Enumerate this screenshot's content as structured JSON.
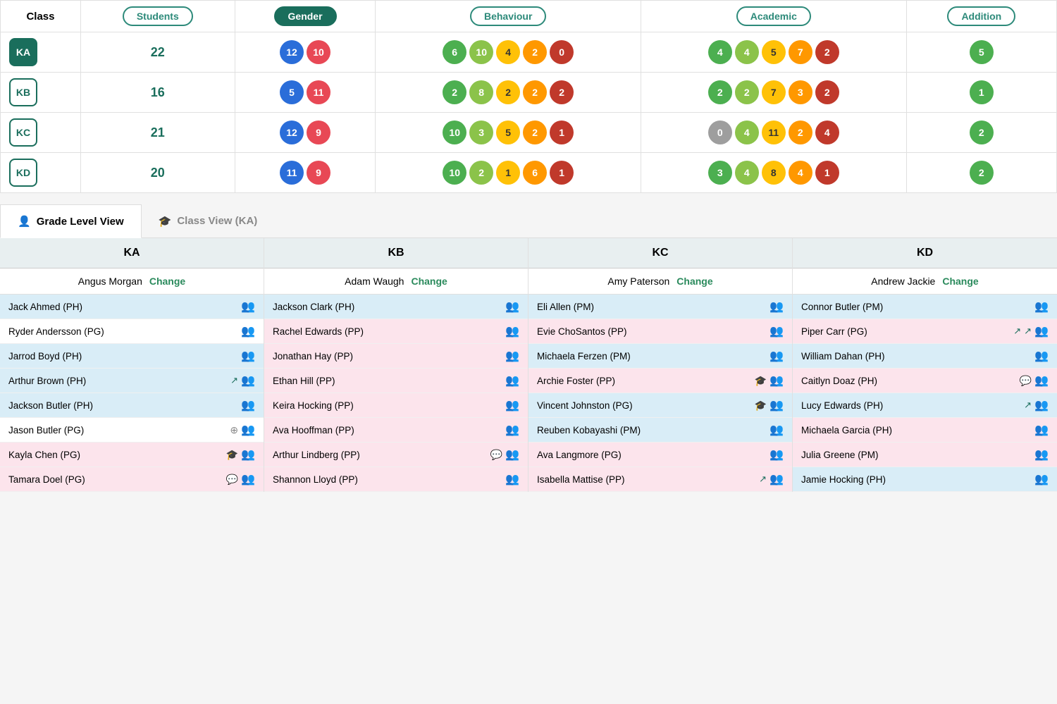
{
  "header": {
    "class_label": "Class",
    "students_label": "Students",
    "gender_label": "Gender",
    "behaviour_label": "Behaviour",
    "academic_label": "Academic",
    "additional_label": "Addition"
  },
  "rows": [
    {
      "class": "KA",
      "class_style": "filled",
      "students": "22",
      "gender": [
        {
          "val": "12",
          "color": "c-blue"
        },
        {
          "val": "10",
          "color": "c-red"
        }
      ],
      "behaviour": [
        {
          "val": "6",
          "color": "c-green"
        },
        {
          "val": "10",
          "color": "c-lightgreen"
        },
        {
          "val": "4",
          "color": "c-yellow"
        },
        {
          "val": "2",
          "color": "c-orange"
        },
        {
          "val": "0",
          "color": "c-darkred"
        }
      ],
      "academic": [
        {
          "val": "4",
          "color": "c-green"
        },
        {
          "val": "4",
          "color": "c-lightgreen"
        },
        {
          "val": "5",
          "color": "c-yellow"
        },
        {
          "val": "7",
          "color": "c-orange"
        },
        {
          "val": "2",
          "color": "c-darkred"
        }
      ],
      "additional": [
        {
          "val": "5",
          "color": "c-green"
        }
      ]
    },
    {
      "class": "KB",
      "class_style": "outline",
      "students": "16",
      "gender": [
        {
          "val": "5",
          "color": "c-blue"
        },
        {
          "val": "11",
          "color": "c-red"
        }
      ],
      "behaviour": [
        {
          "val": "2",
          "color": "c-green"
        },
        {
          "val": "8",
          "color": "c-lightgreen"
        },
        {
          "val": "2",
          "color": "c-yellow"
        },
        {
          "val": "2",
          "color": "c-orange"
        },
        {
          "val": "2",
          "color": "c-darkred"
        }
      ],
      "academic": [
        {
          "val": "2",
          "color": "c-green"
        },
        {
          "val": "2",
          "color": "c-lightgreen"
        },
        {
          "val": "7",
          "color": "c-yellow"
        },
        {
          "val": "3",
          "color": "c-orange"
        },
        {
          "val": "2",
          "color": "c-darkred"
        }
      ],
      "additional": [
        {
          "val": "1",
          "color": "c-green"
        }
      ]
    },
    {
      "class": "KC",
      "class_style": "outline",
      "students": "21",
      "gender": [
        {
          "val": "12",
          "color": "c-blue"
        },
        {
          "val": "9",
          "color": "c-red"
        }
      ],
      "behaviour": [
        {
          "val": "10",
          "color": "c-green"
        },
        {
          "val": "3",
          "color": "c-lightgreen"
        },
        {
          "val": "5",
          "color": "c-yellow"
        },
        {
          "val": "2",
          "color": "c-orange"
        },
        {
          "val": "1",
          "color": "c-darkred"
        }
      ],
      "academic": [
        {
          "val": "0",
          "color": "c-gray"
        },
        {
          "val": "4",
          "color": "c-lightgreen"
        },
        {
          "val": "11",
          "color": "c-yellow"
        },
        {
          "val": "2",
          "color": "c-orange"
        },
        {
          "val": "4",
          "color": "c-darkred"
        }
      ],
      "additional": [
        {
          "val": "2",
          "color": "c-green"
        }
      ]
    },
    {
      "class": "KD",
      "class_style": "outline",
      "students": "20",
      "gender": [
        {
          "val": "11",
          "color": "c-blue"
        },
        {
          "val": "9",
          "color": "c-red"
        }
      ],
      "behaviour": [
        {
          "val": "10",
          "color": "c-green"
        },
        {
          "val": "2",
          "color": "c-lightgreen"
        },
        {
          "val": "1",
          "color": "c-yellow"
        },
        {
          "val": "6",
          "color": "c-orange"
        },
        {
          "val": "1",
          "color": "c-darkred"
        }
      ],
      "academic": [
        {
          "val": "3",
          "color": "c-green"
        },
        {
          "val": "4",
          "color": "c-lightgreen"
        },
        {
          "val": "8",
          "color": "c-yellow"
        },
        {
          "val": "4",
          "color": "c-orange"
        },
        {
          "val": "1",
          "color": "c-darkred"
        }
      ],
      "additional": [
        {
          "val": "2",
          "color": "c-green"
        }
      ]
    }
  ],
  "tabs": [
    {
      "label": "Grade Level View",
      "icon": "👤",
      "active": true
    },
    {
      "label": "Class View (KA)",
      "icon": "🎓",
      "active": false
    }
  ],
  "columns": [
    {
      "header": "KA",
      "teacher": "Angus Morgan",
      "students": [
        {
          "name": "Jack Ahmed (PH)",
          "bg": "bg-blue",
          "icons": [
            "group"
          ]
        },
        {
          "name": "Ryder Andersson (PG)",
          "bg": "bg-white",
          "icons": [
            "group"
          ]
        },
        {
          "name": "Jarrod Boyd (PH)",
          "bg": "bg-blue",
          "icons": [
            "group"
          ]
        },
        {
          "name": "Arthur Brown (PH)",
          "bg": "bg-blue",
          "icons": [
            "arrow-up",
            "group"
          ]
        },
        {
          "name": "Jackson Butler (PH)",
          "bg": "bg-blue",
          "icons": [
            "group"
          ]
        },
        {
          "name": "Jason Butler (PG)",
          "bg": "bg-white",
          "icons": [
            "plus",
            "group"
          ]
        },
        {
          "name": "Kayla Chen (PG)",
          "bg": "bg-pink",
          "icons": [
            "hat",
            "group"
          ]
        },
        {
          "name": "Tamara Doel (PG)",
          "bg": "bg-pink",
          "icons": [
            "chat",
            "group"
          ]
        }
      ]
    },
    {
      "header": "KB",
      "teacher": "Adam Waugh",
      "students": [
        {
          "name": "Jackson Clark (PH)",
          "bg": "bg-blue",
          "icons": [
            "group"
          ]
        },
        {
          "name": "Rachel Edwards (PP)",
          "bg": "bg-pink",
          "icons": [
            "group"
          ]
        },
        {
          "name": "Jonathan Hay (PP)",
          "bg": "bg-pink",
          "icons": [
            "group"
          ]
        },
        {
          "name": "Ethan Hill (PP)",
          "bg": "bg-pink",
          "icons": [
            "group"
          ]
        },
        {
          "name": "Keira Hocking (PP)",
          "bg": "bg-pink",
          "icons": [
            "group"
          ]
        },
        {
          "name": "Ava Hooffman (PP)",
          "bg": "bg-pink",
          "icons": [
            "group"
          ]
        },
        {
          "name": "Arthur Lindberg (PP)",
          "bg": "bg-pink",
          "icons": [
            "chat",
            "group"
          ]
        },
        {
          "name": "Shannon Lloyd (PP)",
          "bg": "bg-pink",
          "icons": [
            "group"
          ]
        }
      ]
    },
    {
      "header": "KC",
      "teacher": "Amy Paterson",
      "students": [
        {
          "name": "Eli Allen (PM)",
          "bg": "bg-blue",
          "icons": [
            "group"
          ]
        },
        {
          "name": "Evie ChoSantos (PP)",
          "bg": "bg-pink",
          "icons": [
            "group"
          ]
        },
        {
          "name": "Michaela Ferzen (PM)",
          "bg": "bg-blue",
          "icons": [
            "group"
          ]
        },
        {
          "name": "Archie Foster (PP)",
          "bg": "bg-pink",
          "icons": [
            "hat",
            "group"
          ]
        },
        {
          "name": "Vincent Johnston (PG)",
          "bg": "bg-blue",
          "icons": [
            "hat",
            "group"
          ]
        },
        {
          "name": "Reuben Kobayashi (PM)",
          "bg": "bg-blue",
          "icons": [
            "group"
          ]
        },
        {
          "name": "Ava Langmore (PG)",
          "bg": "bg-pink",
          "icons": [
            "group"
          ]
        },
        {
          "name": "Isabella Mattise (PP)",
          "bg": "bg-pink",
          "icons": [
            "arrow-diag",
            "group"
          ]
        }
      ]
    },
    {
      "header": "KD",
      "teacher": "Andrew Jackie",
      "students": [
        {
          "name": "Connor Butler (PM)",
          "bg": "bg-blue",
          "icons": [
            "group"
          ]
        },
        {
          "name": "Piper Carr (PG)",
          "bg": "bg-pink",
          "icons": [
            "arrow-up",
            "arrow-diag",
            "group"
          ]
        },
        {
          "name": "William Dahan (PH)",
          "bg": "bg-blue",
          "icons": [
            "group"
          ]
        },
        {
          "name": "Caitlyn Doaz (PH)",
          "bg": "bg-pink",
          "icons": [
            "chat",
            "group"
          ]
        },
        {
          "name": "Lucy Edwards (PH)",
          "bg": "bg-blue",
          "icons": [
            "arrow-up",
            "group"
          ]
        },
        {
          "name": "Michaela Garcia (PH)",
          "bg": "bg-pink",
          "icons": [
            "group"
          ]
        },
        {
          "name": "Julia Greene (PM)",
          "bg": "bg-pink",
          "icons": [
            "group"
          ]
        },
        {
          "name": "Jamie Hocking (PH)",
          "bg": "bg-blue",
          "icons": [
            "group"
          ]
        }
      ]
    }
  ]
}
